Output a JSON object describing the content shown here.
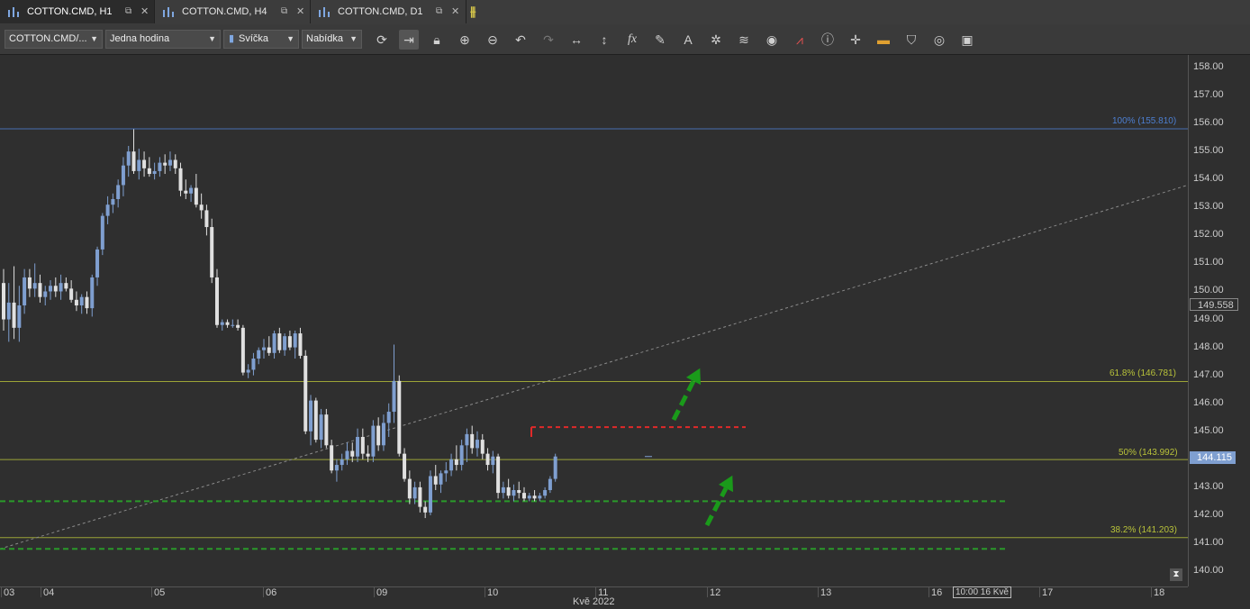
{
  "tabs": [
    {
      "label": "COTTON.CMD, H1",
      "active": true
    },
    {
      "label": "COTTON.CMD, H4",
      "active": false
    },
    {
      "label": "COTTON.CMD, D1",
      "active": false
    }
  ],
  "toolbar": {
    "instrument": "COTTON.CMD/...",
    "period": "Jedna hodina",
    "chart_type": "Svíčka",
    "price_side": "Nabídka"
  },
  "price_axis": {
    "ticks": [
      "158.00",
      "157.00",
      "156.00",
      "155.00",
      "154.00",
      "153.00",
      "152.00",
      "151.00",
      "150.00",
      "149.00",
      "148.00",
      "147.00",
      "146.00",
      "145.00",
      "144.00",
      "143.00",
      "142.00",
      "141.00",
      "140.00"
    ],
    "marker_line": "149.558",
    "marker_current": "144.115"
  },
  "time_axis": {
    "ticks": [
      "03",
      "04",
      "05",
      "06",
      "09",
      "10",
      "11",
      "12",
      "13",
      "16",
      "17",
      "18"
    ],
    "month": "Kvě 2022",
    "cursor_label": "10:00 16 Kvě"
  },
  "fib_levels": [
    {
      "label": "100% (155.810)",
      "value": 155.81,
      "color": "#4d7fd1"
    },
    {
      "label": "61.8% (146.781)",
      "value": 146.781,
      "color": "#b8c23a"
    },
    {
      "label": "50% (143.992)",
      "value": 143.992,
      "color": "#b8c23a"
    },
    {
      "label": "38.2% (141.203)",
      "value": 141.203,
      "color": "#b8c23a"
    }
  ],
  "colors": {
    "bull_candle": "#7f9fd0",
    "bear_candle": "#e0e0e0",
    "resistance": "#e02a2a",
    "support": "#2a9a2a",
    "arrow": "#1a9a1a",
    "trendline": "#8a8a8a"
  },
  "annotations": {
    "resistance_value": 145.15,
    "support_values": [
      142.5,
      140.8
    ]
  }
}
